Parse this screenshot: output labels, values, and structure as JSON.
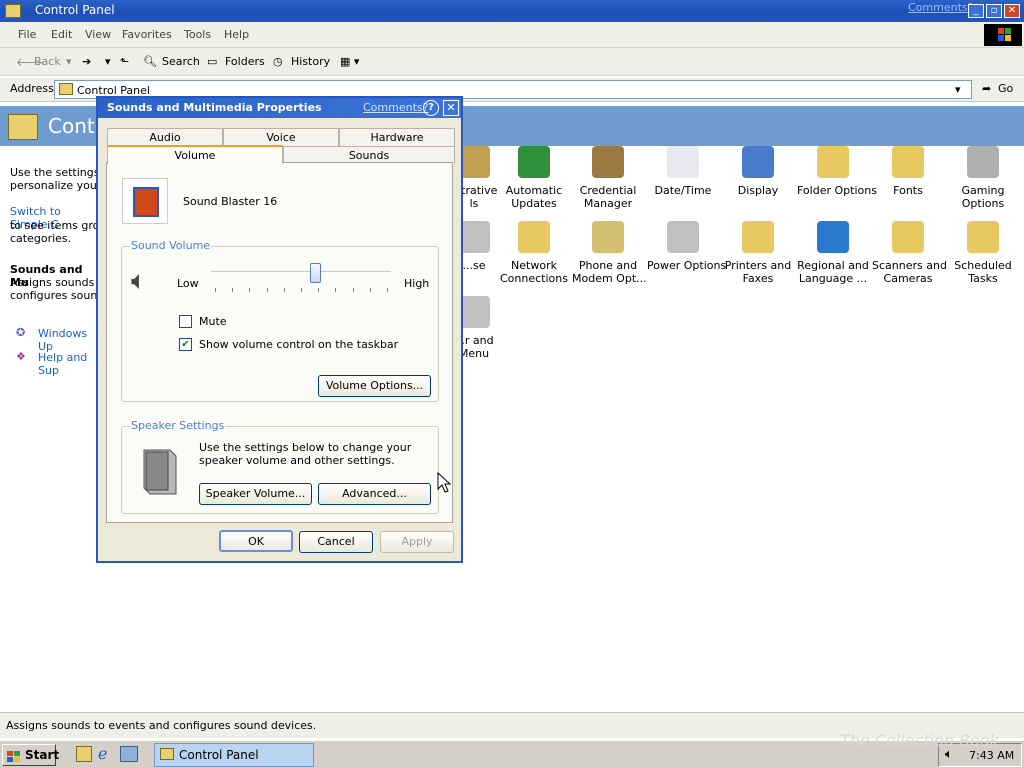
{
  "window": {
    "title": "Control Panel",
    "comments_link": "Comments?",
    "min": "_",
    "max": "▫",
    "close": "✕"
  },
  "menu": [
    "File",
    "Edit",
    "View",
    "Favorites",
    "Tools",
    "Help"
  ],
  "toolbar": {
    "back": "Back",
    "search": "Search",
    "folders": "Folders",
    "history": "History"
  },
  "address": {
    "label": "Address",
    "value": "Control Panel",
    "go": "Go"
  },
  "header": {
    "title": "Contr"
  },
  "left_pane": {
    "intro": "Use the settings in\npersonalize your c",
    "switch_link": "Switch to Simple C",
    "switch_rest": "to see items group\ncategories.",
    "section_title": "Sounds and Mu",
    "section_desc": "Assigns sounds to\nconfigures sound",
    "links": [
      "Windows Up",
      "Help and Sup"
    ]
  },
  "icons": [
    {
      "label": "...trative\nls",
      "color": "#c0a050"
    },
    {
      "label": "Automatic\nUpdates",
      "color": "#2f8f3a"
    },
    {
      "label": "Credential\nManager",
      "color": "#9a7a40"
    },
    {
      "label": "Date/Time",
      "color": "#e8e8f0"
    },
    {
      "label": "Display",
      "color": "#4a7acb"
    },
    {
      "label": "Folder Options",
      "color": "#e8c860"
    },
    {
      "label": "Fonts",
      "color": "#e8c860"
    },
    {
      "label": "Gaming\nOptions",
      "color": "#b0b0b0"
    },
    {
      "label": "...se",
      "color": "#c0c0c0"
    },
    {
      "label": "Network\nConnections",
      "color": "#e8c860"
    },
    {
      "label": "Phone and\nModem Opt...",
      "color": "#d4c070"
    },
    {
      "label": "Power Options",
      "color": "#c0c0c0"
    },
    {
      "label": "Printers and\nFaxes",
      "color": "#e8c860"
    },
    {
      "label": "Regional and\nLanguage ...",
      "color": "#2a7ad0"
    },
    {
      "label": "Scanners and\nCameras",
      "color": "#e8c860"
    },
    {
      "label": "Scheduled\nTasks",
      "color": "#e8c860"
    },
    {
      "label": "...r and\nMenu",
      "color": "#c0c0c0"
    }
  ],
  "status_text": "Assigns sounds to events and configures sound devices.",
  "taskbar": {
    "start": "Start",
    "task": "Control Panel",
    "clock": "7:43 AM"
  },
  "dialog": {
    "title": "Sounds and Multimedia Properties",
    "comments": "Comments?",
    "help": "?",
    "close": "✕",
    "tabs_back": [
      "Audio",
      "Voice",
      "Hardware"
    ],
    "tabs_front": [
      "Volume",
      "Sounds"
    ],
    "device_name": "Sound Blaster 16",
    "sound_volume": {
      "title": "Sound Volume",
      "low": "Low",
      "high": "High",
      "level": 0.58,
      "mute_label": "Mute",
      "mute_checked": false,
      "show_taskbar_label": "Show volume control on the taskbar",
      "show_taskbar_checked": true,
      "options_button": "Volume Options..."
    },
    "speaker": {
      "title": "Speaker Settings",
      "desc": "Use the settings below to change your speaker volume and other settings.",
      "volume_button": "Speaker Volume...",
      "advanced_button": "Advanced..."
    },
    "ok": "OK",
    "cancel": "Cancel",
    "apply": "Apply"
  },
  "watermark": "The Collection Book"
}
